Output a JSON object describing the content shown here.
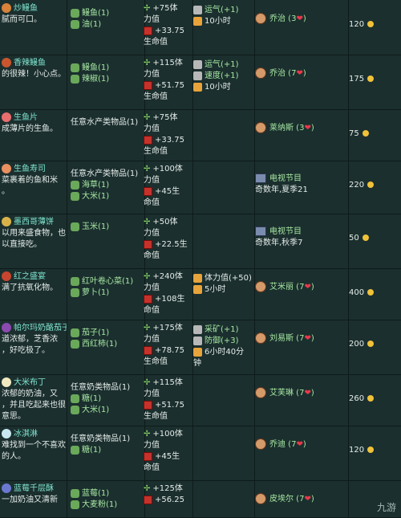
{
  "rows": [
    {
      "name": "炒鳗鱼",
      "desc": "腻而可口。",
      "ingredients": [
        {
          "text": "鳗鱼(1)",
          "color": "#a6e7a2"
        },
        {
          "text": "油(1)",
          "color": "#a6e7a2"
        }
      ],
      "effects": {
        "energy": "+75体",
        "energy2": "力值",
        "health": "+33.75",
        "health2": "生命值"
      },
      "buffs": [
        {
          "text": "运气(+1)",
          "kind": "green"
        },
        {
          "text": "10小时",
          "kind": "white"
        }
      ],
      "loves": [
        {
          "text": "乔治 (3",
          "heart": "❤)"
        }
      ],
      "price": "120"
    },
    {
      "name": "香辣鳗鱼",
      "desc": "的很辣！小心点。",
      "ingredients": [
        {
          "text": "鳗鱼(1)",
          "color": "#a6e7a2"
        },
        {
          "text": "辣椒(1)",
          "color": "#a6e7a2"
        }
      ],
      "effects": {
        "energy": "+115体",
        "energy2": "力值",
        "health": "+51.75",
        "health2": "生命值"
      },
      "buffs": [
        {
          "text": "运气(+1)",
          "kind": "green"
        },
        {
          "text": "速度(+1)",
          "kind": "green"
        },
        {
          "text": "10小时",
          "kind": "white"
        }
      ],
      "loves": [
        {
          "text": "乔治 (7",
          "heart": "❤)"
        }
      ],
      "price": "175"
    },
    {
      "name": "生鱼片",
      "desc": "成薄片的生鱼。",
      "ingredients": [
        {
          "text": "任意水产类物品(1)",
          "color": "#e4ece9"
        }
      ],
      "effects": {
        "energy": "+75体",
        "energy2": "力值",
        "health": "+33.75",
        "health2": "生命值"
      },
      "buffs": [],
      "loves": [
        {
          "text": "莱纳斯 (3",
          "heart": "❤)"
        }
      ],
      "price": "75"
    },
    {
      "name": "生鱼寿司",
      "desc": "菜裹着的鱼和米",
      "desc2": "。",
      "ingredients": [
        {
          "text": "任意水产类物品(1)",
          "color": "#e4ece9"
        },
        {
          "text": "海草(1)",
          "color": "#a6e7a2"
        },
        {
          "text": "大米(1)",
          "color": "#a6e7a2"
        }
      ],
      "effects": {
        "energy": "+100体",
        "energy2": "力值",
        "health": "+45生",
        "health2": "命值"
      },
      "buffs": [],
      "loves": [
        {
          "text": "电视节目",
          "heart": ""
        },
        {
          "text": "奇数年,夏季21",
          "heart": "",
          "sub": true
        }
      ],
      "price": "220"
    },
    {
      "name": "墨西哥薄饼",
      "desc": "以用来盛食物，也",
      "desc2": "以直接吃。",
      "ingredients": [
        {
          "text": "玉米(1)",
          "color": "#a6e7a2"
        }
      ],
      "effects": {
        "energy": "+50体",
        "energy2": "力值",
        "health": "+22.5生",
        "health2": "命值"
      },
      "buffs": [],
      "loves": [
        {
          "text": "电视节目",
          "heart": ""
        },
        {
          "text": "奇数年,秋季7",
          "heart": "",
          "sub": true
        }
      ],
      "price": "50"
    },
    {
      "name": "红之盛宴",
      "desc": "满了抗氧化物。",
      "ingredients": [
        {
          "text": "红叶卷心菜(1)",
          "color": "#a6e7a2"
        },
        {
          "text": "萝卜(1)",
          "color": "#a6e7a2"
        }
      ],
      "effects": {
        "energy": "+240体",
        "energy2": "力值",
        "health": "+108生",
        "health2": "命值"
      },
      "buffs": [
        {
          "text": "体力值(+50)",
          "kind": "white"
        },
        {
          "text": "5小时",
          "kind": "white"
        }
      ],
      "loves": [
        {
          "text": "艾米丽 (7",
          "heart": "❤)"
        }
      ],
      "price": "400"
    },
    {
      "name": "帕尔玛奶酪茄子",
      "desc": "道浓郁，芝香浓",
      "desc2": "，好吃极了。",
      "ingredients": [
        {
          "text": "茄子(1)",
          "color": "#a6e7a2"
        },
        {
          "text": "西红柿(1)",
          "color": "#a6e7a2"
        }
      ],
      "effects": {
        "energy": "+175体",
        "energy2": "力值",
        "health": "+78.75",
        "health2": "生命值"
      },
      "buffs": [
        {
          "text": "采矿(+1)",
          "kind": "green"
        },
        {
          "text": "防御(+3)",
          "kind": "green"
        },
        {
          "text": "6小时40分",
          "kind": "white"
        },
        {
          "text": "钟",
          "kind": "white"
        }
      ],
      "loves": [
        {
          "text": "刘易斯 (7",
          "heart": "❤)"
        }
      ],
      "price": "200"
    },
    {
      "name": "大米布丁",
      "desc": "浓郁的奶油，又",
      "desc2": "，并且吃起来也很",
      "desc3": "意思。",
      "ingredients": [
        {
          "text": "任意奶类物品(1)",
          "color": "#e4ece9"
        },
        {
          "text": "糖(1)",
          "color": "#a6e7a2"
        },
        {
          "text": "大米(1)",
          "color": "#a6e7a2"
        }
      ],
      "effects": {
        "energy": "+115体",
        "energy2": "力值",
        "health": "+51.75",
        "health2": "生命值"
      },
      "buffs": [],
      "loves": [
        {
          "text": "艾芙琳 (7",
          "heart": "❤)"
        }
      ],
      "price": "260"
    },
    {
      "name": "冰淇淋",
      "desc": "难找到一个不喜欢",
      "desc2": "的人。",
      "ingredients": [
        {
          "text": "任意奶类物品(1)",
          "color": "#e4ece9"
        },
        {
          "text": "糖(1)",
          "color": "#a6e7a2"
        }
      ],
      "effects": {
        "energy": "+100体",
        "energy2": "力值",
        "health": "+45生",
        "health2": "命值"
      },
      "buffs": [],
      "loves": [
        {
          "text": "乔迪 (7",
          "heart": "❤)"
        }
      ],
      "price": "120"
    },
    {
      "name": "蓝莓千层酥",
      "desc": "一加奶油又清新",
      "ingredients": [
        {
          "text": "蓝莓(1)",
          "color": "#a6e7a2"
        },
        {
          "text": "大麦粉(1)",
          "color": "#a6e7a2"
        }
      ],
      "effects": {
        "energy": "+125体",
        "energy2": "",
        "health": "+56.25",
        "health2": ""
      },
      "buffs": [],
      "loves": [
        {
          "text": "皮埃尔 (7",
          "heart": "❤)"
        }
      ],
      "price": ""
    }
  ],
  "watermark": "九游",
  "colors": {
    "bg": "#1b2f2e",
    "green": "#a6e7a2",
    "name": "#7fe5d0",
    "heart": "#e8394a"
  }
}
